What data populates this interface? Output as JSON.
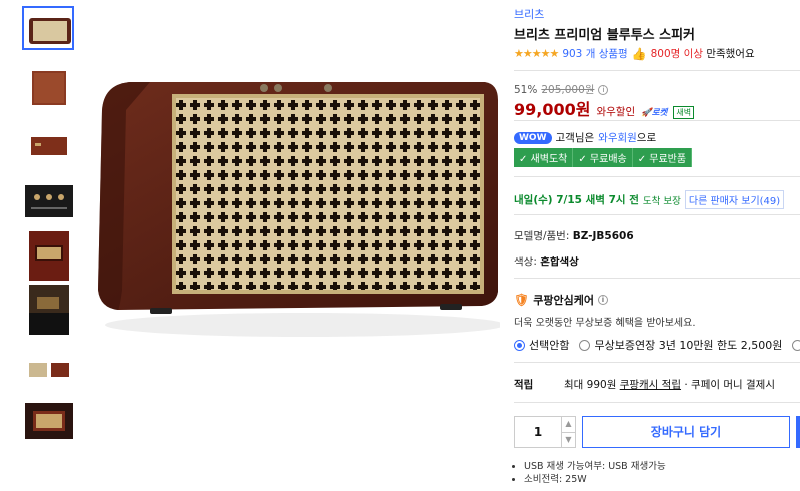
{
  "thumbnails": [
    {
      "name": "thumb-speaker-front",
      "kind": "speaker"
    },
    {
      "name": "thumb-wood-back",
      "kind": "wood"
    },
    {
      "name": "thumb-wood-side",
      "kind": "wood-side"
    },
    {
      "name": "thumb-dark-controls",
      "kind": "dark"
    },
    {
      "name": "thumb-red-room",
      "kind": "red"
    },
    {
      "name": "thumb-living-room",
      "kind": "room"
    },
    {
      "name": "thumb-two-colors",
      "kind": "pair"
    },
    {
      "name": "thumb-dark-box",
      "kind": "dark2"
    }
  ],
  "product": {
    "brand": "브리츠",
    "title": "브리츠 프리미엄 블루투스 스피커",
    "stars": "★★★★★",
    "review_count": "903 개 상품평",
    "satisfaction_count": "800명 이상",
    "satisfaction_suffix": "만족했어요"
  },
  "price": {
    "discount_rate": "51%",
    "original": "205,000원",
    "sale": "99,000원",
    "wow_sale": "와우할인",
    "rocket": "🚀로켓",
    "dawn_badge": "새벽"
  },
  "wow": {
    "badge": "WOW",
    "prefix": "고객님은",
    "member": "와우회원",
    "suffix": "으로"
  },
  "benefits": [
    "✓ 새벽도착",
    "✓ 무료배송",
    "✓ 무료반품"
  ],
  "delivery": {
    "date_text": "내일(수) 7/15 새벽 7시 전",
    "note": "도착 보장",
    "other_sellers": "다른 판매자 보기",
    "other_count": "(49)"
  },
  "specs": {
    "model_label": "모델명/품번:",
    "model_value": "BZ-JB5606",
    "color_label": "색상:",
    "color_value": "혼합색상"
  },
  "care": {
    "title": "쿠팡안심케어",
    "desc": "더욱 오랫동안 무상보증 혜택을 받아보세요.",
    "options": [
      "선택안함",
      "무상보증연장 3년 10만원 한도 2,500원"
    ]
  },
  "points": {
    "label": "적립",
    "max": "최대 990원",
    "cash": "쿠팡캐시 적립",
    "pay": "· 쿠페이 머니 결제시"
  },
  "cart": {
    "qty": "1",
    "add_label": "장바구니 담기"
  },
  "bullets": [
    "USB 재생 가능여부: USB 재생가능",
    "소비전력: 25W"
  ],
  "colors": {
    "accent": "#346aff",
    "price_red": "#ae0000",
    "green": "#2e9e4f",
    "wood": "#5a2418",
    "grille": "#d9c8a0"
  }
}
